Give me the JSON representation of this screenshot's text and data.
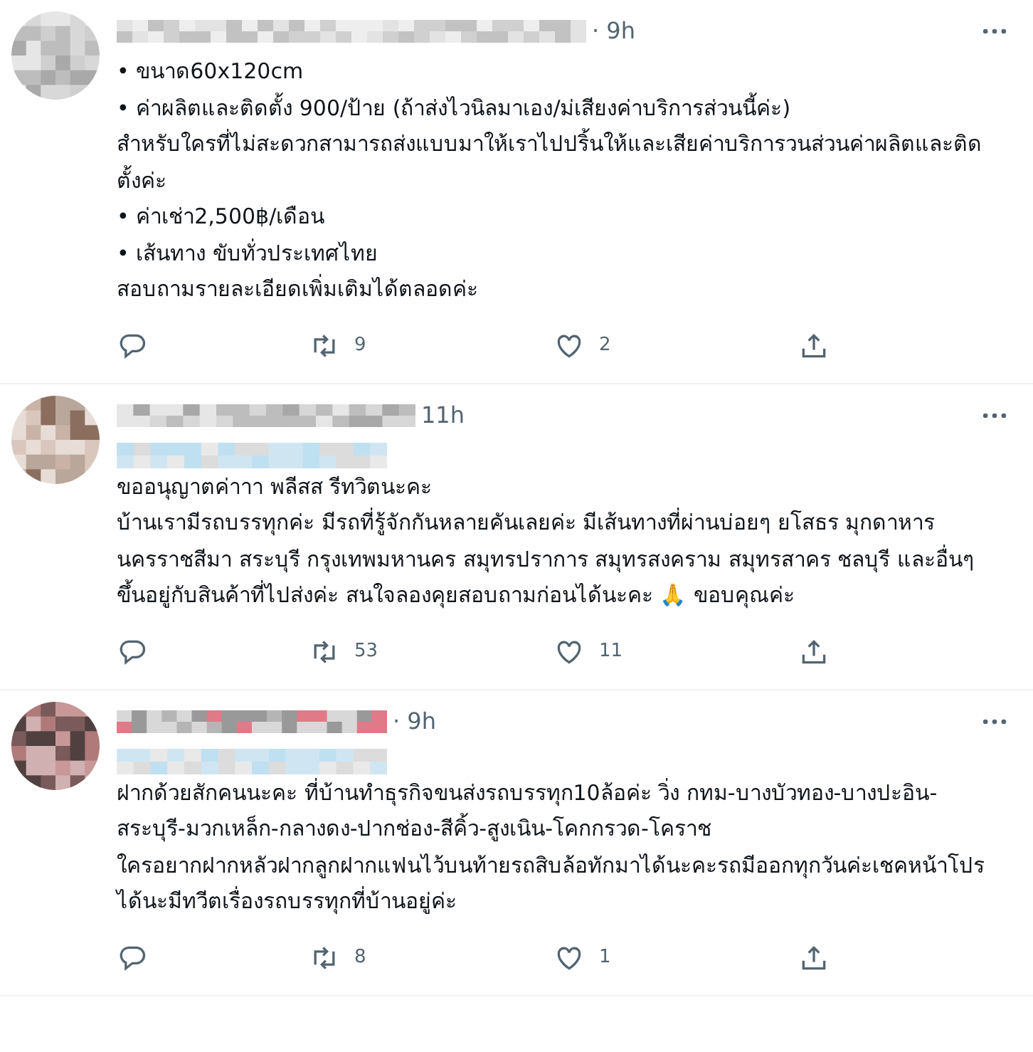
{
  "tweets": [
    {
      "time": "· 9h",
      "second_line": false,
      "text": "• ขนาด60x120cm\n• ค่าผลิตและติดตั้ง 900/ป้าย (ถ้าส่งไวนิลมาเอง/ม่เสียงค่าบริการส่วนนี้ค่ะ)\nสำหรับใครที่ไม่สะดวกสามารถส่งแบบมาให้เราไปปริ้นให้และเสียค่าบริการวนส่วนค่าผลิตและติดตั้งค่ะ\n• ค่าเช่า2,500฿/เดือน\n• เส้นทาง ขับทั่วประเทศไทย\nสอบถามรายละเอียดเพิ่มเติมได้ตลอดค่ะ",
      "retweets": "9",
      "likes": "2"
    },
    {
      "time": "11h",
      "second_line": true,
      "text": "ขออนุญาตค่าาา พลีสส รีทวิตนะคะ\nบ้านเรามีรถบรรทุกค่ะ มีรถที่รู้จักกันหลายคันเลยค่ะ  มีเส้นทางที่ผ่านบ่อยๆ ยโสธร มุกดาหาร นครราชสีมา สระบุรี กรุงเทพมหานคร สมุทรปราการ สมุทรสงคราม สมุทรสาคร ชลบุรี และอื่นๆ ขึ้นอยู่กับสินค้าที่ไปส่งค่ะ สนใจลองคุยสอบถามก่อนได้นะคะ 🙏 ขอบคุณค่ะ",
      "retweets": "53",
      "likes": "11"
    },
    {
      "time": "· 9h",
      "second_line": true,
      "text": "ฝากด้วยสักคนนะคะ ที่บ้านทำธุรกิจขนส่งรถบรรทุก10ล้อค่ะ วิ่ง กทม-บางบัวทอง-บางปะอิน-สระบุรี-มวกเหล็ก-กลางดง-ปากช่อง-สีคิ้ว-สูงเนิน-โคกกรวด-โคราช\nใครอยากฝากหลัวฝากลูกฝากแฟนไว้บนท้ายรถสิบล้อทักมาได้นะคะรถมีออกทุกวันค่ะเชคหน้าโปรได้นะมีทวีตเรื่องรถบรรทุกที่บ้านอยู่ค่ะ",
      "retweets": "8",
      "likes": "1"
    }
  ]
}
